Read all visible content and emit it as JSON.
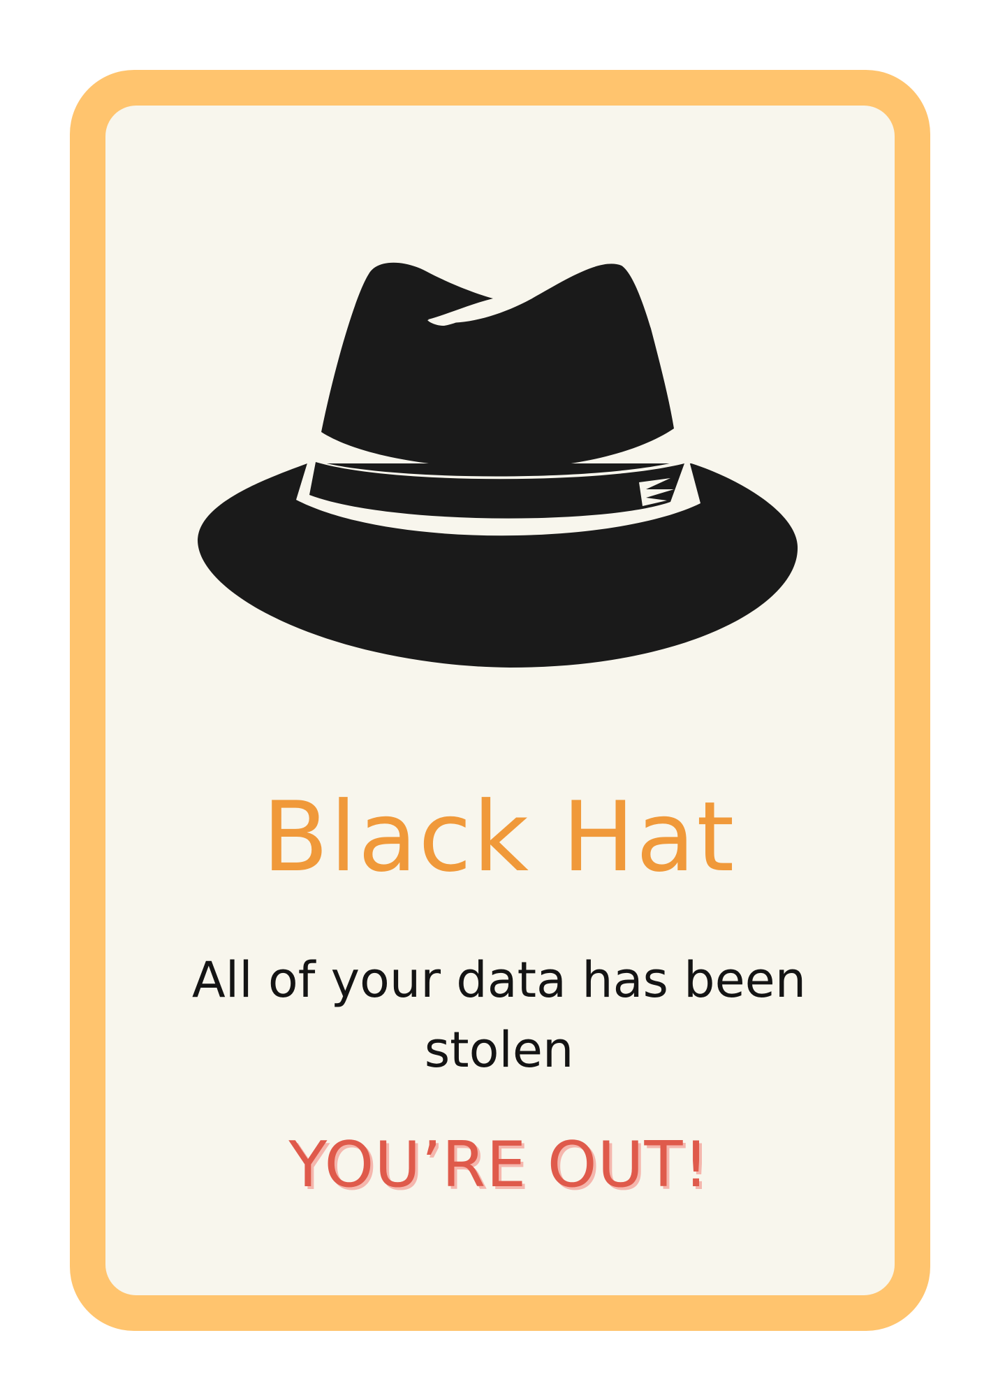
{
  "card": {
    "title": "Black Hat",
    "message": "All of your data has been stolen",
    "outcome": "YOU’RE OUT!",
    "icon": "fedora-hat-icon"
  },
  "colors": {
    "frame": "#ffc46e",
    "background": "#f8f6ed",
    "title": "#f0993a",
    "message": "#141414",
    "outcome": "#df5a4b",
    "outcome_shadow": "#f5b6ad",
    "hat": "#1a1a1a",
    "hat_band": "#f8f6ed"
  }
}
